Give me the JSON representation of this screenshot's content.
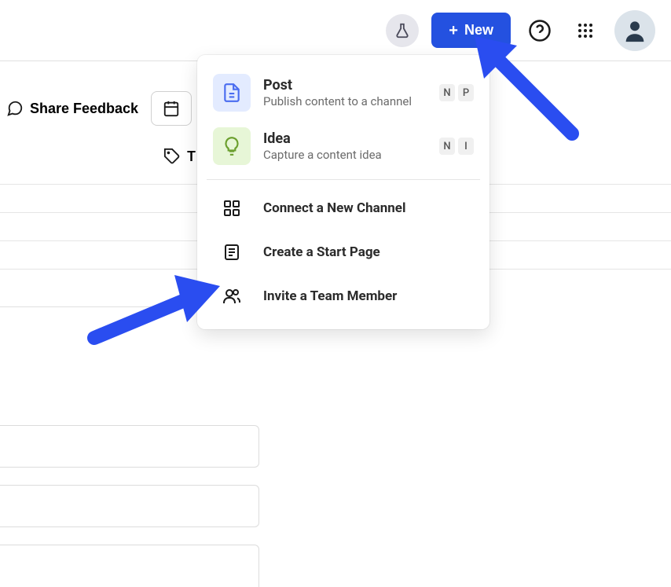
{
  "header": {
    "new_label": "New"
  },
  "toolbar": {
    "feedback_label": "Share Feedback",
    "tags_label": "T"
  },
  "dropdown": {
    "post": {
      "title": "Post",
      "subtitle": "Publish content to a channel",
      "keys": [
        "N",
        "P"
      ]
    },
    "idea": {
      "title": "Idea",
      "subtitle": "Capture a content idea",
      "keys": [
        "N",
        "I"
      ]
    },
    "actions": {
      "connect": "Connect a New Channel",
      "startpage": "Create a Start Page",
      "invite": "Invite a Team Member"
    }
  }
}
